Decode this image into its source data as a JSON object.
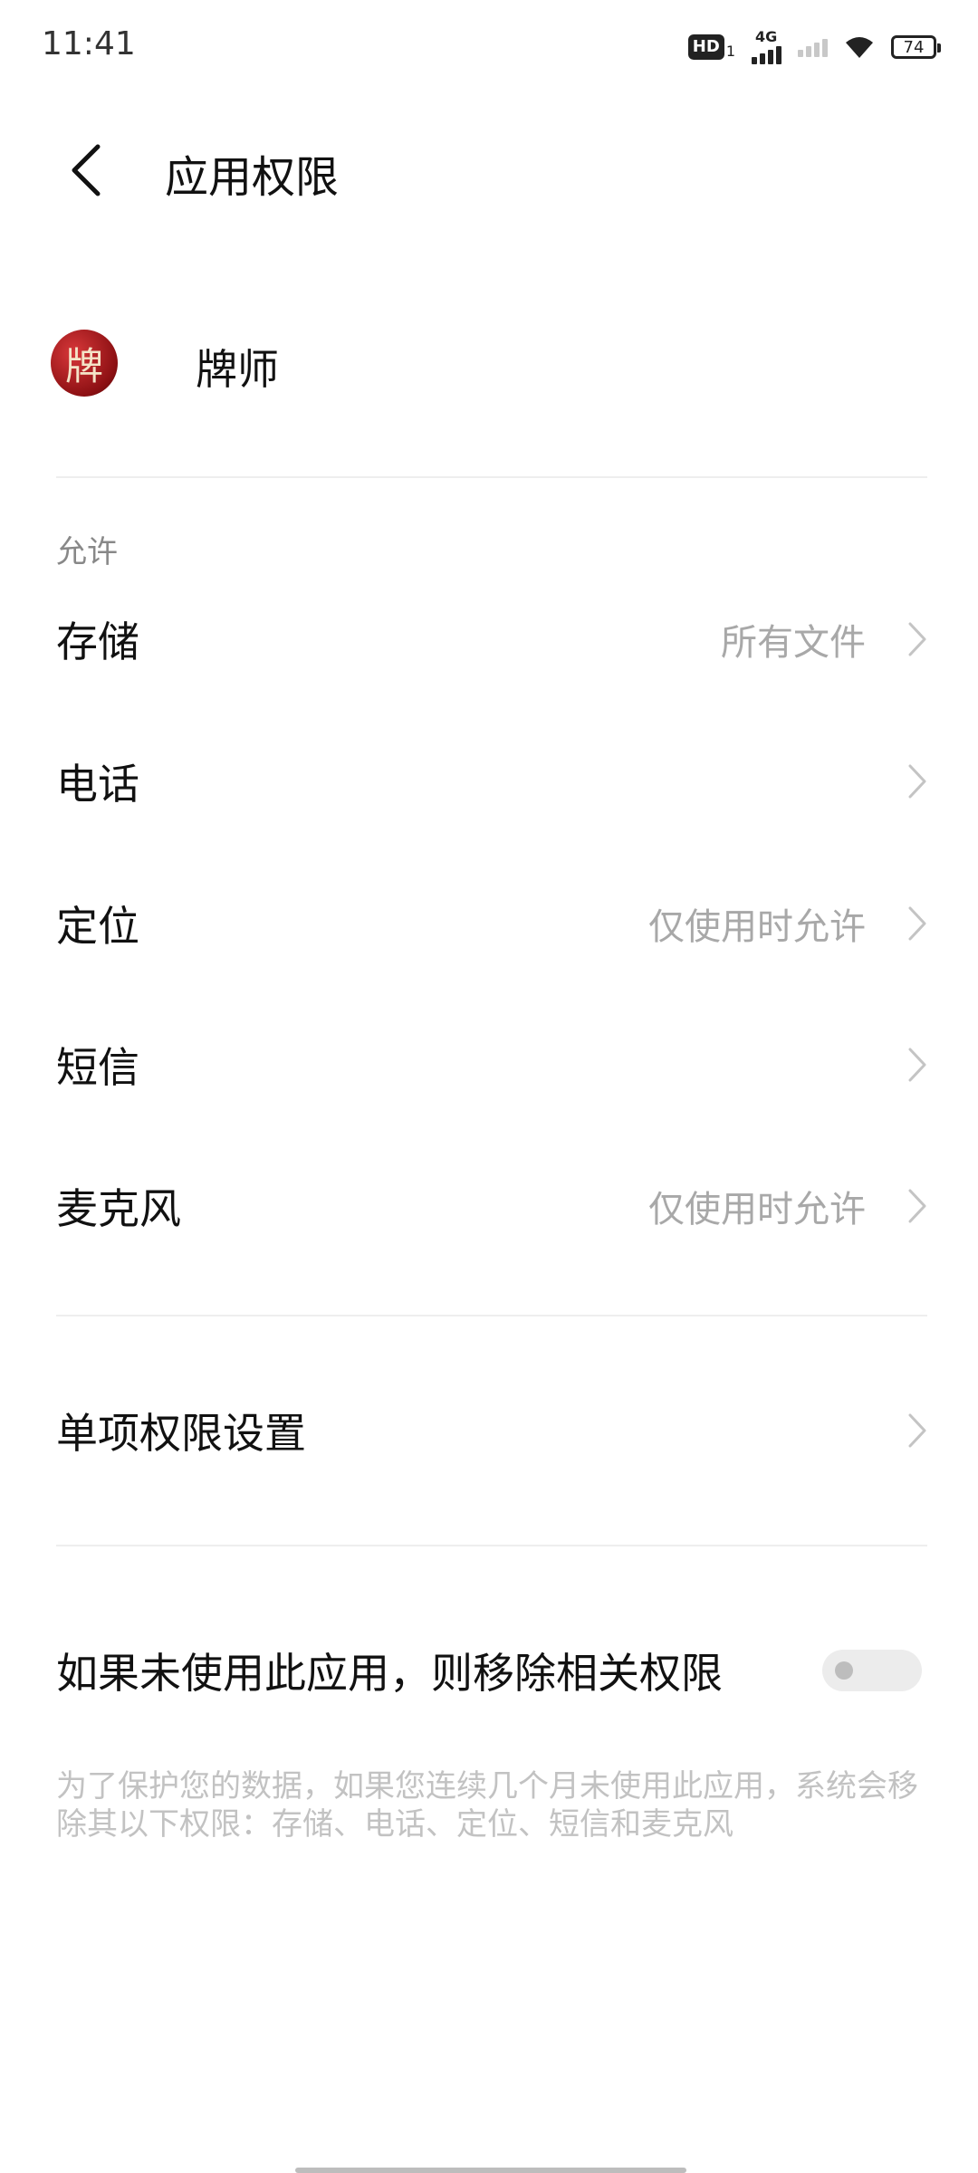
{
  "status_bar": {
    "time": "11:41",
    "hd_label": "HD",
    "hd_sub": "1",
    "network_label": "4G",
    "battery": "74"
  },
  "header": {
    "title": "应用权限",
    "back_icon": "chevron-left-icon"
  },
  "app": {
    "name": "牌师",
    "icon_glyph": "牌"
  },
  "allowed": {
    "section_label": "允许",
    "items": [
      {
        "label": "存储",
        "value": "所有文件"
      },
      {
        "label": "电话",
        "value": ""
      },
      {
        "label": "定位",
        "value": "仅使用时允许"
      },
      {
        "label": "短信",
        "value": ""
      },
      {
        "label": "麦克风",
        "value": "仅使用时允许"
      }
    ]
  },
  "individual": {
    "label": "单项权限设置"
  },
  "auto_remove": {
    "label": "如果未使用此应用，则移除相关权限",
    "enabled": false,
    "description": "为了保护您的数据，如果您连续几个月未使用此应用，系统会移除其以下权限：存储、电话、定位、短信和麦克风"
  },
  "colors": {
    "primary_text": "#111111",
    "secondary_text": "#a8a8a8",
    "divider": "#eeeeee",
    "toggle_off": "#ececec"
  }
}
